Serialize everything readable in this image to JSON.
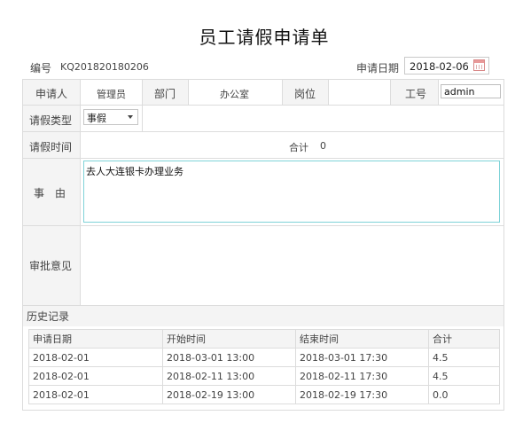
{
  "title": "员工请假申请单",
  "meta": {
    "number_label": "编号",
    "number_value": "KQ201820180206",
    "date_label": "申请日期",
    "date_value": "2018-02-06"
  },
  "form": {
    "applicant_label": "申请人",
    "applicant_value": "管理员",
    "dept_label": "部门",
    "dept_value": "办公室",
    "position_label": "岗位",
    "position_value": "",
    "id_label": "工号",
    "id_value": "admin",
    "type_label": "请假类型",
    "type_value": "事假",
    "time_label": "请假时间",
    "total_label": "合计",
    "total_value": "0",
    "reason_label": "事　由",
    "reason_value": "去人大连银卡办理业务",
    "approval_label": "审批意见",
    "approval_value": ""
  },
  "history": {
    "title": "历史记录",
    "columns": [
      "申请日期",
      "开始时间",
      "结束时间",
      "合计"
    ],
    "rows": [
      [
        "2018-02-01",
        "2018-03-01 13:00",
        "2018-03-01 17:30",
        "4.5"
      ],
      [
        "2018-02-01",
        "2018-02-11 13:00",
        "2018-02-11 17:30",
        "4.5"
      ],
      [
        "2018-02-01",
        "2018-02-19 13:00",
        "2018-02-19 17:30",
        "0.0"
      ]
    ]
  },
  "icons": {
    "calendar": "calendar-icon",
    "dropdown": "chevron-down-icon"
  }
}
